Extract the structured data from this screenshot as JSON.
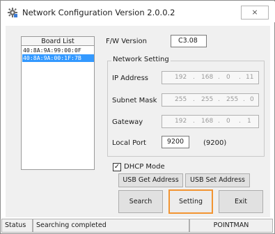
{
  "window": {
    "title": "Network Configuration  Version 2.0.0.2",
    "close_glyph": "⨯"
  },
  "board_list": {
    "header": "Board List",
    "items": [
      {
        "label": "40:8A:9A:99:00:0F",
        "selected": false
      },
      {
        "label": "40:8A:9A:00:1F:7B",
        "selected": true
      }
    ]
  },
  "fw": {
    "label": "F/W Version",
    "value": "C3.08"
  },
  "network": {
    "group_title": "Network Setting",
    "ip_address": {
      "label": "IP Address",
      "octets": [
        "192",
        "168",
        "0",
        "11"
      ]
    },
    "subnet_mask": {
      "label": "Subnet Mask",
      "octets": [
        "255",
        "255",
        "255",
        "0"
      ]
    },
    "gateway": {
      "label": "Gateway",
      "octets": [
        "192",
        "168",
        "0",
        "1"
      ]
    },
    "local_port": {
      "label": "Local Port",
      "value": "9200",
      "hint": "(9200)"
    },
    "separator": "."
  },
  "dhcp": {
    "label": "DHCP Mode",
    "checked": true,
    "check_glyph": "✓"
  },
  "buttons": {
    "usb_get": "USB Get Address",
    "usb_set": "USB Set Address",
    "search": "Search",
    "setting": "Setting",
    "exit": "Exit"
  },
  "status": {
    "label": "Status",
    "message": "Searching completed",
    "brand": "POINTMAN"
  },
  "colors": {
    "selection": "#3399ff",
    "focus_border": "#f29431"
  },
  "icons": {
    "app": "network-config-icon",
    "close": "close-icon",
    "check": "checkmark-icon"
  }
}
